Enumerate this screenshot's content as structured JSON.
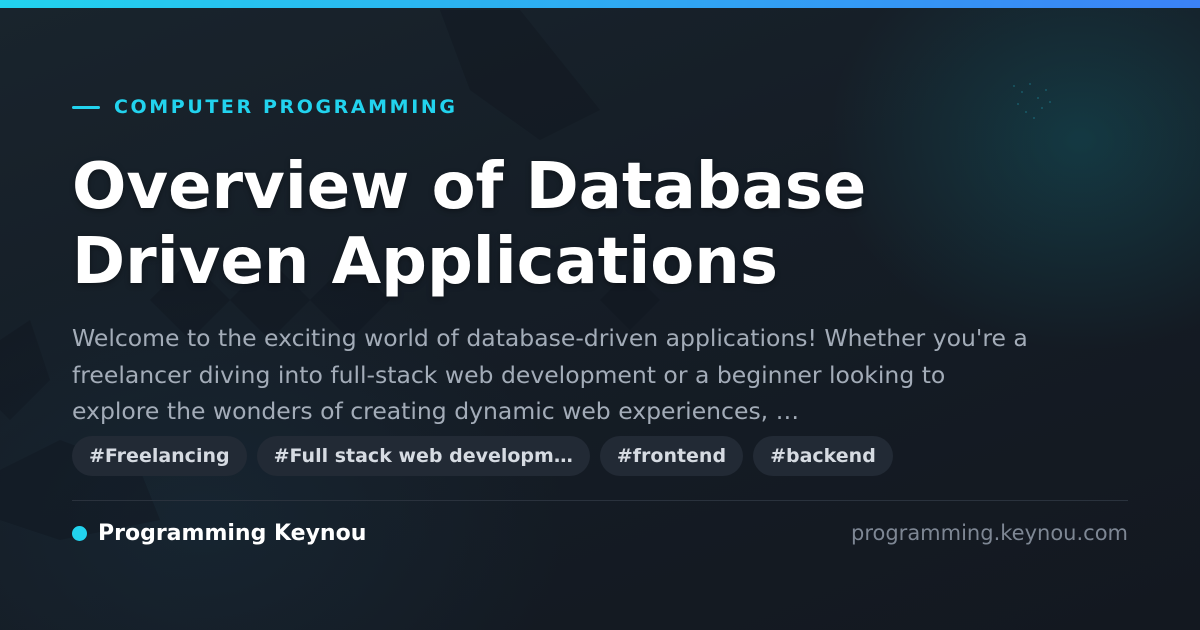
{
  "theme": {
    "accent": "#22d3ee",
    "accent_end": "#3b82f6",
    "background": "#141a22",
    "title_color": "#ffffff",
    "text_muted": "#a3acb8",
    "tag_background": "#222a35"
  },
  "category": "COMPUTER PROGRAMMING",
  "title_lines": [
    "Overview of Database",
    "Driven Applications"
  ],
  "description": "Welcome to the exciting world of database-driven applications! Whether you're a freelancer diving into full-stack web development or a beginner looking to explore the wonders of creating dynamic web experiences, …",
  "tags": [
    {
      "label": "#Freelancing"
    },
    {
      "label": "#Full stack web developm…"
    },
    {
      "label": "#frontend"
    },
    {
      "label": "#backend"
    }
  ],
  "footer": {
    "author": "Programming Keynou",
    "site": "programming.keynou.com"
  }
}
